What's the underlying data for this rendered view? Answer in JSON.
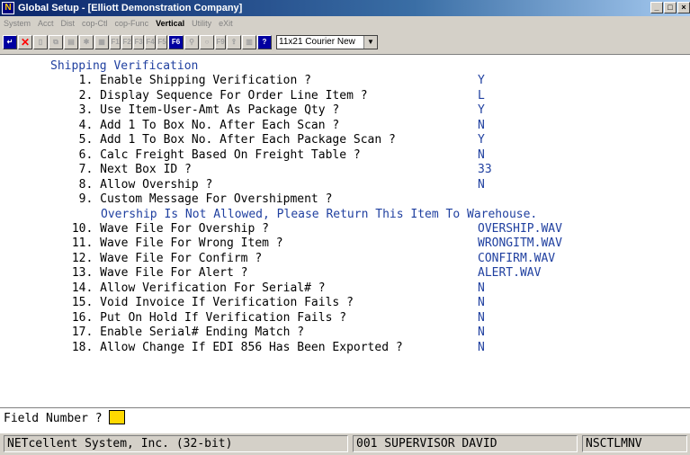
{
  "window": {
    "title": "Global Setup - [Elliott Demonstration Company]"
  },
  "menu": [
    "System",
    "Acct",
    "Dist",
    "cop-Ctl",
    "cop-Func",
    "Vertical",
    "Utility",
    "eXit"
  ],
  "toolbar": {
    "font_value": "11x21 Courier New",
    "fkeys": [
      "F1",
      "F2",
      "F3",
      "F4",
      "F5",
      "F6"
    ]
  },
  "screen": {
    "heading": "Shipping Verification",
    "fields": [
      {
        "label": "  1. Enable Shipping Verification ?",
        "value": "Y"
      },
      {
        "label": "  2. Display Sequence For Order Line Item ?",
        "value": "L"
      },
      {
        "label": "  3. Use Item-User-Amt As Package Qty ?",
        "value": "Y"
      },
      {
        "label": "  4. Add 1 To Box No. After Each Scan ?",
        "value": "N"
      },
      {
        "label": "  5. Add 1 To Box No. After Each Package Scan ?",
        "value": "Y"
      },
      {
        "label": "  6. Calc Freight Based On Freight Table ?",
        "value": "N"
      },
      {
        "label": "  7. Next Box ID ?",
        "value": "33"
      },
      {
        "label": "  8. Allow Overship ?",
        "value": "N"
      },
      {
        "label": "  9. Custom Message For Overshipment ?",
        "value": ""
      },
      {
        "label": " 10. Wave File For Overship ?",
        "value": "OVERSHIP.WAV"
      },
      {
        "label": " 11. Wave File For Wrong Item ?",
        "value": "WRONGITM.WAV"
      },
      {
        "label": " 12. Wave File For Confirm ?",
        "value": "CONFIRM.WAV"
      },
      {
        "label": " 13. Wave File For Alert ?",
        "value": "ALERT.WAV"
      },
      {
        "label": " 14. Allow Verification For Serial# ?",
        "value": "N"
      },
      {
        "label": " 15. Void Invoice If Verification Fails ?",
        "value": "N"
      },
      {
        "label": " 16. Put On Hold If Verification Fails ?",
        "value": "N"
      },
      {
        "label": " 17. Enable Serial# Ending Match ?",
        "value": "N"
      },
      {
        "label": " 18. Allow Change If EDI 856 Has Been Exported ?",
        "value": "N"
      }
    ],
    "overship_message": "Overship Is Not Allowed, Please Return This Item To Warehouse."
  },
  "prompt": {
    "label": "Field Number ?"
  },
  "status": {
    "company": "NETcellent System, Inc. (32-bit)",
    "user": "001 SUPERVISOR DAVID",
    "program": "NSCTLMNV"
  },
  "colors": {
    "accent_text": "#2040a0",
    "cursor": "#ffd800",
    "chrome": "#d4d0c8"
  }
}
